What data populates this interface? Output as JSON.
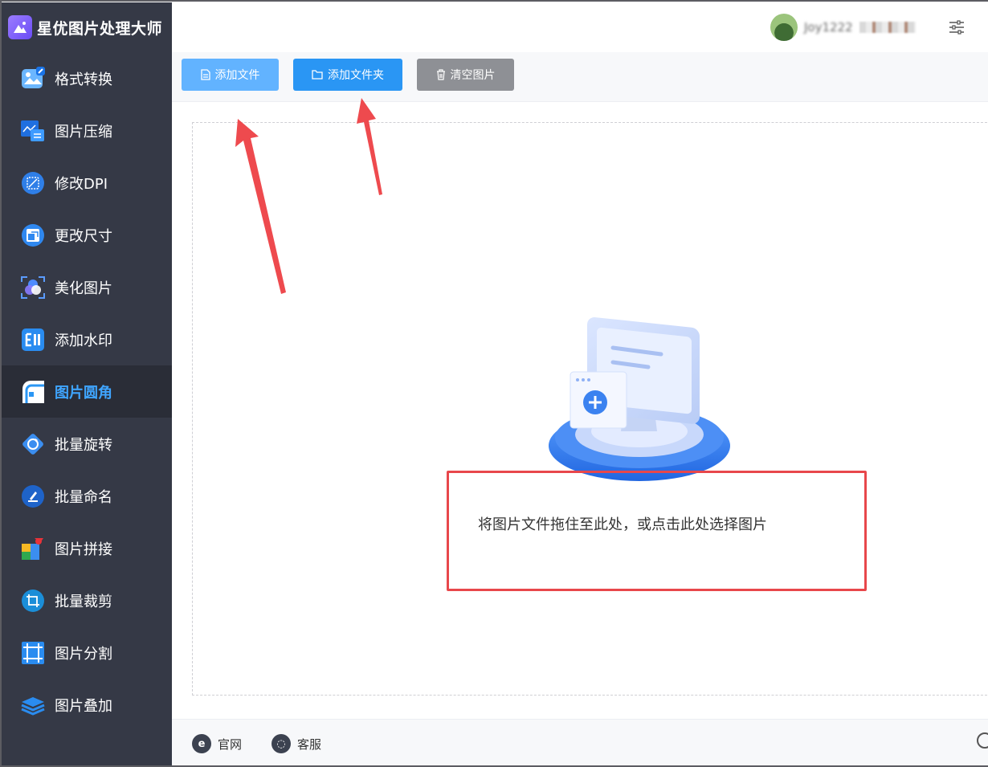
{
  "app": {
    "title": "星优图片处理大师"
  },
  "sidebar": {
    "items": [
      {
        "label": "格式转换",
        "icon": "image-convert-icon"
      },
      {
        "label": "图片压缩",
        "icon": "compress-icon"
      },
      {
        "label": "修改DPI",
        "icon": "dpi-icon"
      },
      {
        "label": "更改尺寸",
        "icon": "resize-icon"
      },
      {
        "label": "美化图片",
        "icon": "beautify-icon"
      },
      {
        "label": "添加水印",
        "icon": "watermark-icon"
      },
      {
        "label": "图片圆角",
        "icon": "rounded-corner-icon",
        "active": true
      },
      {
        "label": "批量旋转",
        "icon": "rotate-icon"
      },
      {
        "label": "批量命名",
        "icon": "rename-icon"
      },
      {
        "label": "图片拼接",
        "icon": "puzzle-icon"
      },
      {
        "label": "批量裁剪",
        "icon": "crop-icon"
      },
      {
        "label": "图片分割",
        "icon": "split-icon"
      },
      {
        "label": "图片叠加",
        "icon": "layers-icon"
      }
    ]
  },
  "header": {
    "username": "Joy1222"
  },
  "toolbar": {
    "add_file": "添加文件",
    "add_folder": "添加文件夹",
    "clear": "清空图片"
  },
  "main": {
    "drop_hint": "将图片文件拖住至此处，或点击此处选择图片"
  },
  "footer": {
    "website": "官网",
    "support": "客服"
  },
  "colors": {
    "sidebar_bg": "#353946",
    "active_text": "#3fa5ff",
    "primary": "#2a96f4",
    "annotation": "#e8474b"
  }
}
